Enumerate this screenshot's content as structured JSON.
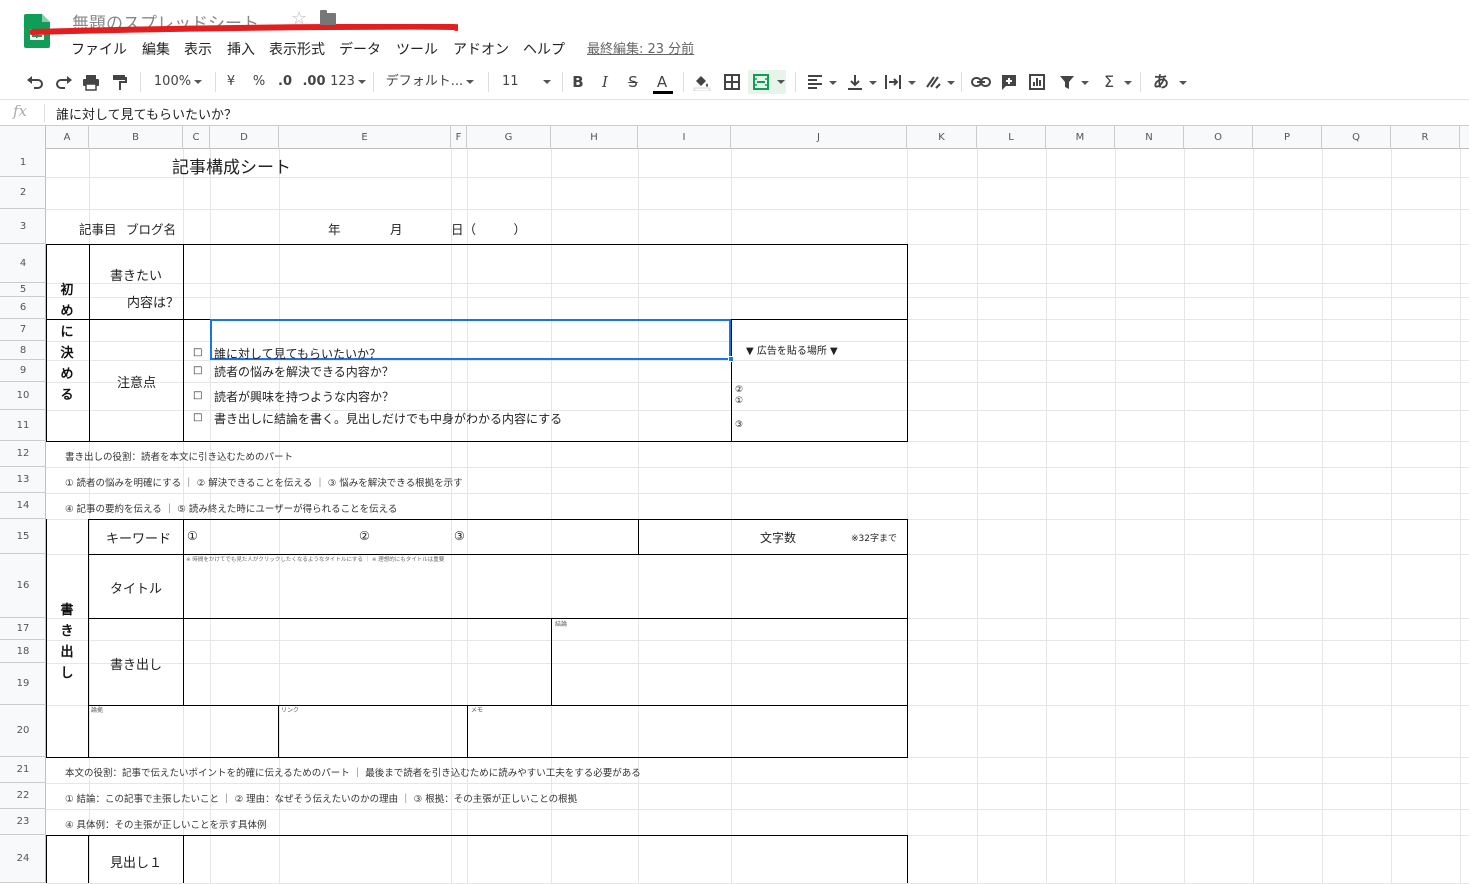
{
  "header": {
    "doc_title": "無題のスプレッドシート",
    "menu": [
      "ファイル",
      "編集",
      "表示",
      "挿入",
      "表示形式",
      "データ",
      "ツール",
      "アドオン",
      "ヘルプ"
    ],
    "last_edit": "最終編集: 23 分前"
  },
  "toolbar": {
    "zoom": "100%",
    "currency": "¥",
    "percent": "%",
    "dec_decrease": ".0",
    "dec_increase": ".00",
    "more_formats": "123",
    "font": "デフォルト...",
    "font_size": "11",
    "bold": "B",
    "italic": "I",
    "strike": "S",
    "text_color": "A",
    "input_tools": "あ"
  },
  "formula_bar": {
    "fx": "fx",
    "value": "誰に対して見てもらいたいか？"
  },
  "columns": [
    "A",
    "B",
    "C",
    "D",
    "E",
    "F",
    "G",
    "H",
    "I",
    "J",
    "K",
    "L",
    "M",
    "N",
    "O",
    "P",
    "Q",
    "R"
  ],
  "rows": [
    "1",
    "2",
    "3",
    "4",
    "5",
    "6",
    "7",
    "8",
    "9",
    "10",
    "11",
    "12",
    "13",
    "14",
    "15",
    "16",
    "17",
    "18",
    "19",
    "20",
    "21",
    "22",
    "23",
    "24"
  ],
  "sheet": {
    "title": "記事構成シート",
    "r3_kijime": "記事目",
    "r3_blog": "ブログ名",
    "r3_year": "年",
    "r3_month": "月",
    "r3_day": "日（　　　）",
    "sec1_vertical": [
      "初",
      "め",
      "に",
      "決",
      "め",
      "る"
    ],
    "want_line1": "書きたい",
    "want_line2": "内容は？",
    "caution": "注意点",
    "bullet": "□",
    "caution_items": [
      "誰に対して見てもらいたいか？",
      "読者の悩みを解決できる内容か？",
      "読者が興味を持つような内容か？",
      "書き出しに結論を書く。見出しだけでも中身がわかる内容にする"
    ],
    "ad_place": "▼ 広告を貼る場所 ▼",
    "ad_2": "②",
    "ad_1": "①",
    "ad_3": "③",
    "note12": "書き出しの役割：読者を本文に引き込むためのパート",
    "note13": "① 読者の悩みを明確にする ｜ ② 解決できることを伝える ｜ ③ 悩みを解決できる根拠を示す",
    "note14": "④ 記事の要約を伝える ｜ ⑤ 読み終えた時にユーザーが得られることを伝える",
    "sec2_vertical": [
      "書",
      "き",
      "出",
      "し"
    ],
    "keyword": "キーワード",
    "kw1": "①",
    "kw2": "②",
    "kw3": "③",
    "char_count": "文字数",
    "char_limit": "※32字まで",
    "title_hint": "※ 時間をかけてでも見た人がクリックしたくなるようなタイトルにする ｜ ※ 理想的にもタイトルは重要",
    "title_label": "タイトル",
    "conclusion_label": "結論",
    "intro_label": "書き出し",
    "sub_a": "論拠",
    "sub_b": "リンク",
    "sub_c": "メモ",
    "note21": "本文の役割：記事で伝えたいポイントを的確に伝えるためのパート ｜ 最後まで読者を引き込むために読みやすい工夫をする必要がある",
    "note22": "① 結論：この記事で主張したいこと ｜ ② 理由：なぜそう伝えたいのかの理由 ｜ ③ 根拠：その主張が正しいことの根拠",
    "note23": "④ 具体例：その主張が正しいことを示す具体例",
    "heading1": "見出し１"
  },
  "colors": {
    "accent_green": "#0f9d58",
    "selection_blue": "#1a73e8",
    "annotation_red": "#e41e1e"
  }
}
